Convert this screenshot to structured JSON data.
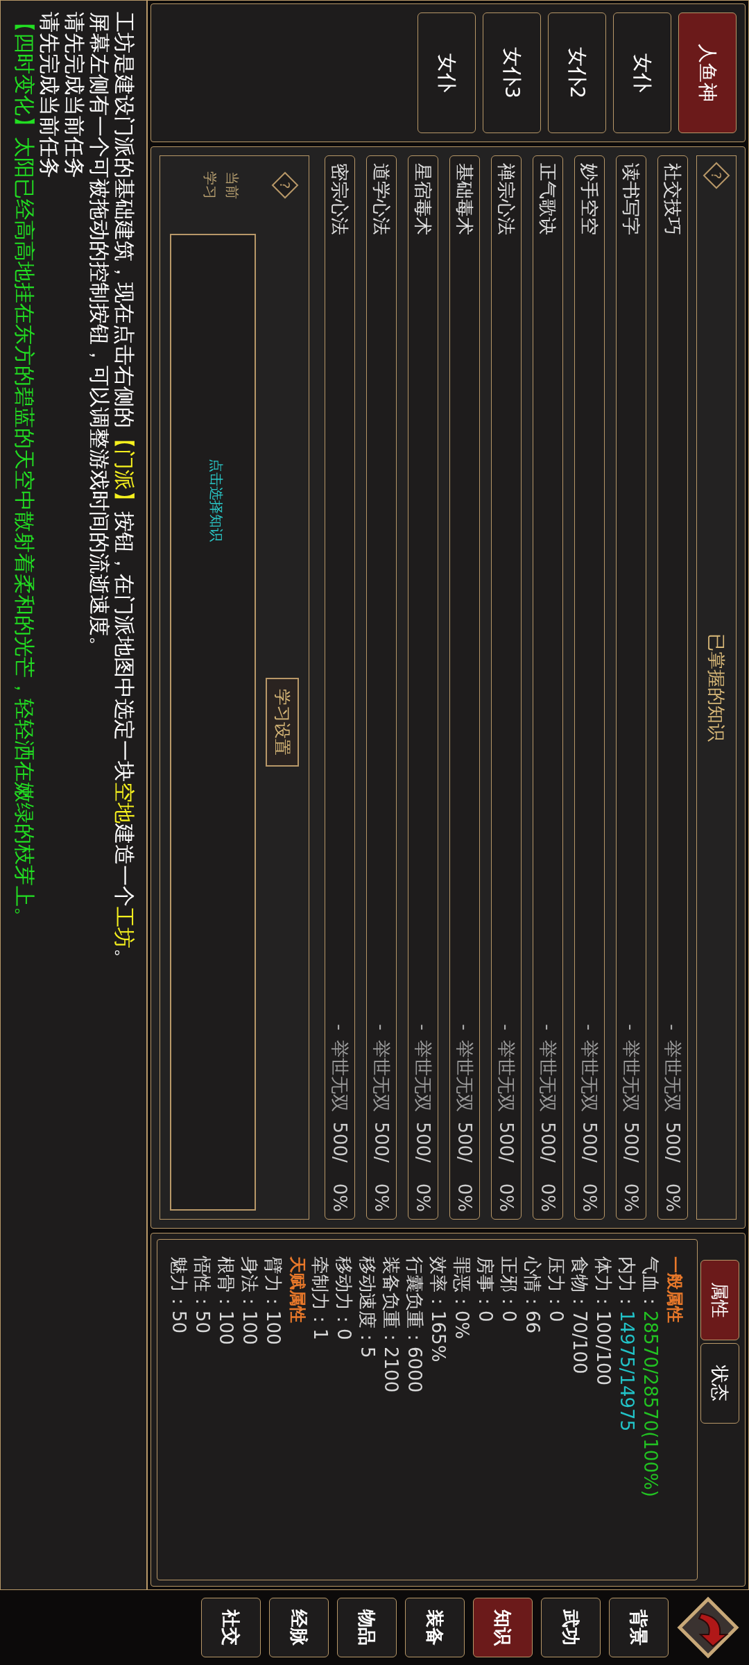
{
  "characters": [
    {
      "name": "人鱼神",
      "selected": true
    },
    {
      "name": "女仆",
      "selected": false
    },
    {
      "name": "女仆2",
      "selected": false
    },
    {
      "name": "女仆3",
      "selected": false
    },
    {
      "name": "女仆",
      "selected": false
    }
  ],
  "knowledge": {
    "help": "?",
    "title": "已掌握的知识",
    "items": [
      {
        "name": "社交技巧",
        "dash": "-",
        "rank": "举世无双",
        "points": "500/",
        "progress": "0%"
      },
      {
        "name": "读书写字",
        "dash": "-",
        "rank": "举世无双",
        "points": "500/",
        "progress": "0%"
      },
      {
        "name": "妙手空空",
        "dash": "-",
        "rank": "举世无双",
        "points": "500/",
        "progress": "0%"
      },
      {
        "name": "正气歌诀",
        "dash": "-",
        "rank": "举世无双",
        "points": "500/",
        "progress": "0%"
      },
      {
        "name": "禅宗心法",
        "dash": "-",
        "rank": "举世无双",
        "points": "500/",
        "progress": "0%"
      },
      {
        "name": "基础毒术",
        "dash": "-",
        "rank": "举世无双",
        "points": "500/",
        "progress": "0%"
      },
      {
        "name": "星宿毒术",
        "dash": "-",
        "rank": "举世无双",
        "points": "500/",
        "progress": "0%"
      },
      {
        "name": "道学心法",
        "dash": "-",
        "rank": "举世无双",
        "points": "500/",
        "progress": "0%"
      },
      {
        "name": "密宗心法",
        "dash": "-",
        "rank": "举世无双",
        "points": "500/",
        "progress": "0%"
      }
    ]
  },
  "study": {
    "help": "?",
    "label": "当前学习",
    "button": "学习设置",
    "hint": "点击选择知识"
  },
  "attributes": {
    "tabs": [
      {
        "label": "属性",
        "selected": true
      },
      {
        "label": "状态",
        "selected": false
      }
    ],
    "rows": [
      {
        "kind": "header",
        "text": "一般属性"
      },
      {
        "kind": "stat",
        "label": "气血：",
        "value": "28570/28570(100%)",
        "color": "#22c322"
      },
      {
        "kind": "stat",
        "label": "内力：",
        "value": "14975/14975",
        "color": "#22c3c8"
      },
      {
        "kind": "stat",
        "label": "体力：",
        "value": "100/100",
        "color": "#d8d8d8"
      },
      {
        "kind": "stat",
        "label": "食物：",
        "value": "70/100",
        "color": "#d8d8d8"
      },
      {
        "kind": "stat",
        "label": "压力：",
        "value": "0",
        "color": "#d8d8d8"
      },
      {
        "kind": "stat",
        "label": "心情：",
        "value": "66",
        "color": "#d8d8d8"
      },
      {
        "kind": "stat",
        "label": "正邪：",
        "value": "0",
        "color": "#d8d8d8"
      },
      {
        "kind": "stat",
        "label": "房事：",
        "value": "0",
        "color": "#d8d8d8"
      },
      {
        "kind": "stat",
        "label": "罪恶：",
        "value": "0%",
        "color": "#d8d8d8"
      },
      {
        "kind": "stat",
        "label": "效率：",
        "value": "165%",
        "color": "#d8d8d8"
      },
      {
        "kind": "stat",
        "label": "行囊负重：",
        "value": "6000",
        "color": "#d8d8d8"
      },
      {
        "kind": "stat",
        "label": "装备负重：",
        "value": "2100",
        "color": "#d8d8d8"
      },
      {
        "kind": "stat",
        "label": "移动速度：",
        "value": "5",
        "color": "#d8d8d8"
      },
      {
        "kind": "stat",
        "label": "移动力：",
        "value": "0",
        "color": "#d8d8d8"
      },
      {
        "kind": "stat",
        "label": "牵制力：",
        "value": "1",
        "color": "#d8d8d8"
      },
      {
        "kind": "header",
        "text": "天赋属性"
      },
      {
        "kind": "stat",
        "label": "臂力：",
        "value": "100",
        "color": "#d8d8d8"
      },
      {
        "kind": "stat",
        "label": "身法：",
        "value": "100",
        "color": "#d8d8d8"
      },
      {
        "kind": "stat",
        "label": "根骨：",
        "value": "100",
        "color": "#d8d8d8"
      },
      {
        "kind": "stat",
        "label": "悟性：",
        "value": "50",
        "color": "#d8d8d8"
      },
      {
        "kind": "stat",
        "label": "魅力：",
        "value": "50",
        "color": "#d8d8d8"
      }
    ]
  },
  "nav": [
    {
      "label": "背景",
      "selected": false
    },
    {
      "label": "武功",
      "selected": false
    },
    {
      "label": "知识",
      "selected": true
    },
    {
      "label": "装备",
      "selected": false
    },
    {
      "label": "物品",
      "selected": false
    },
    {
      "label": "经脉",
      "selected": false
    },
    {
      "label": "社交",
      "selected": false
    }
  ],
  "log": [
    {
      "segments": [
        {
          "text": "工坊是建设门派的基础建筑，现在点击右侧的",
          "color": "#ffffff"
        },
        {
          "text": "【门派】",
          "color": "#f5f01e"
        },
        {
          "text": "按钮，在门派地图中选定一块",
          "color": "#ffffff"
        },
        {
          "text": "空地",
          "color": "#f5f01e"
        },
        {
          "text": "建造一个",
          "color": "#ffffff"
        },
        {
          "text": "工坊",
          "color": "#f5f01e"
        },
        {
          "text": "。",
          "color": "#ffffff"
        }
      ]
    },
    {
      "segments": [
        {
          "text": "屏幕左侧有一个可被拖动的控制按钮，可以调整游戏时间的流逝速度。",
          "color": "#ffffff"
        }
      ]
    },
    {
      "segments": [
        {
          "text": "请先完成当前任务",
          "color": "#ffffff"
        }
      ]
    },
    {
      "segments": [
        {
          "text": "请先完成当前任务",
          "color": "#ffffff"
        }
      ]
    },
    {
      "segments": [
        {
          "text": "【四时变化】太阳已经高高地挂在东方的碧蓝的天空中散射着柔和的光芒，轻轻洒在嫩绿的枝芽上。",
          "color": "#22dd22"
        }
      ]
    }
  ]
}
